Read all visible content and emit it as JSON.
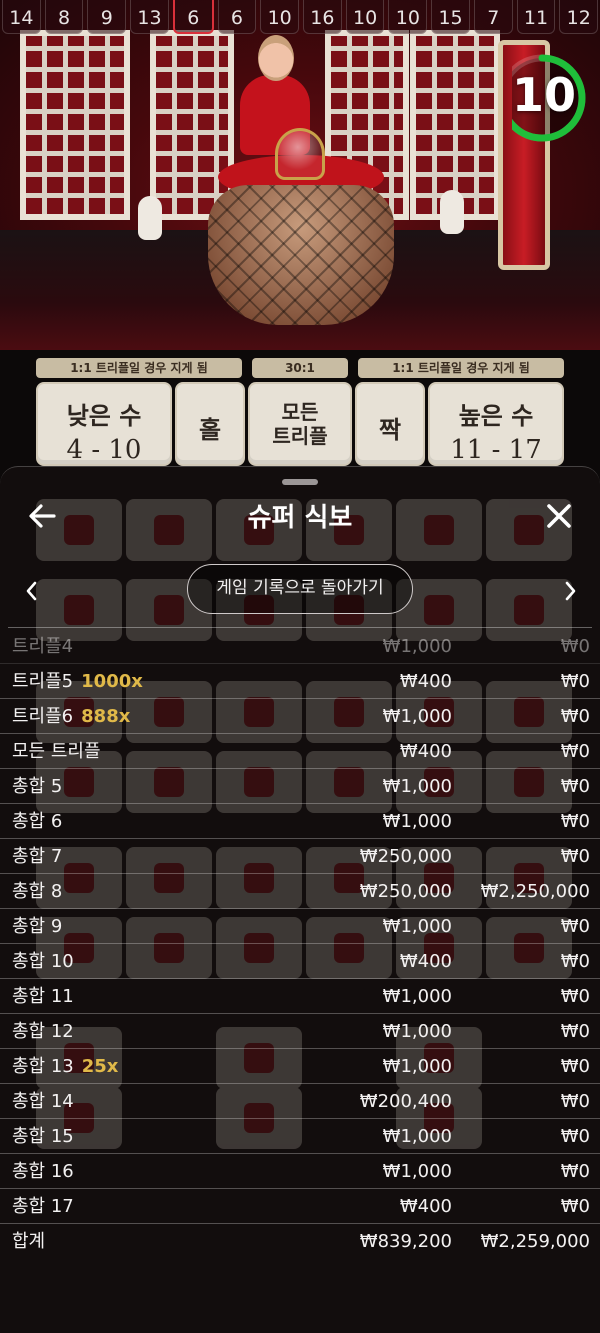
{
  "results_strip": [
    "14",
    "8",
    "9",
    "13",
    "6",
    "6",
    "10",
    "16",
    "10",
    "10",
    "15",
    "7",
    "11",
    "12"
  ],
  "timer": {
    "value": "10",
    "progress": 0.8,
    "color": "#1fbe3a"
  },
  "payouts": {
    "low": "1:1 트리플일 경우 지게 됨",
    "triple": "30:1",
    "high": "1:1 트리플일 경우 지게 됨"
  },
  "bets": {
    "small_label": "낮은 수",
    "small_range": "4 - 10",
    "odd": "홀",
    "any_triple": "모든\n트리플",
    "even": "짝",
    "big_label": "높은 수",
    "big_range": "11 - 17"
  },
  "sheet": {
    "title": "슈퍼 식보",
    "history_button": "게임 기록으로 돌아가기",
    "icons": {
      "back": "arrow-left-icon",
      "close": "close-icon",
      "prev": "chevron-left-icon",
      "next": "chevron-right-icon"
    },
    "rows": [
      {
        "label": "트리플4",
        "mult": "",
        "bet": "₩1,000",
        "win": "₩0"
      },
      {
        "label": "트리플5",
        "mult": "1000x",
        "bet": "₩400",
        "win": "₩0"
      },
      {
        "label": "트리플6",
        "mult": "888x",
        "bet": "₩1,000",
        "win": "₩0"
      },
      {
        "label": "모든 트리플",
        "mult": "",
        "bet": "₩400",
        "win": "₩0"
      },
      {
        "label": "총합 5",
        "mult": "",
        "bet": "₩1,000",
        "win": "₩0"
      },
      {
        "label": "총합 6",
        "mult": "",
        "bet": "₩1,000",
        "win": "₩0"
      },
      {
        "label": "총합 7",
        "mult": "",
        "bet": "₩250,000",
        "win": "₩0"
      },
      {
        "label": "총합 8",
        "mult": "",
        "bet": "₩250,000",
        "win": "₩2,250,000"
      },
      {
        "label": "총합 9",
        "mult": "",
        "bet": "₩1,000",
        "win": "₩0"
      },
      {
        "label": "총합 10",
        "mult": "",
        "bet": "₩400",
        "win": "₩0"
      },
      {
        "label": "총합 11",
        "mult": "",
        "bet": "₩1,000",
        "win": "₩0"
      },
      {
        "label": "총합 12",
        "mult": "",
        "bet": "₩1,000",
        "win": "₩0"
      },
      {
        "label": "총합 13",
        "mult": "25x",
        "bet": "₩1,000",
        "win": "₩0"
      },
      {
        "label": "총합 14",
        "mult": "",
        "bet": "₩200,400",
        "win": "₩0"
      },
      {
        "label": "총합 15",
        "mult": "",
        "bet": "₩1,000",
        "win": "₩0"
      },
      {
        "label": "총합 16",
        "mult": "",
        "bet": "₩1,000",
        "win": "₩0"
      },
      {
        "label": "총합 17",
        "mult": "",
        "bet": "₩400",
        "win": "₩0"
      }
    ],
    "total": {
      "label": "합계",
      "bet": "₩839,200",
      "win": "₩2,259,000"
    }
  },
  "colors": {
    "accent_multiplier": "#e0b949",
    "highlight_result": "#d9303a"
  }
}
